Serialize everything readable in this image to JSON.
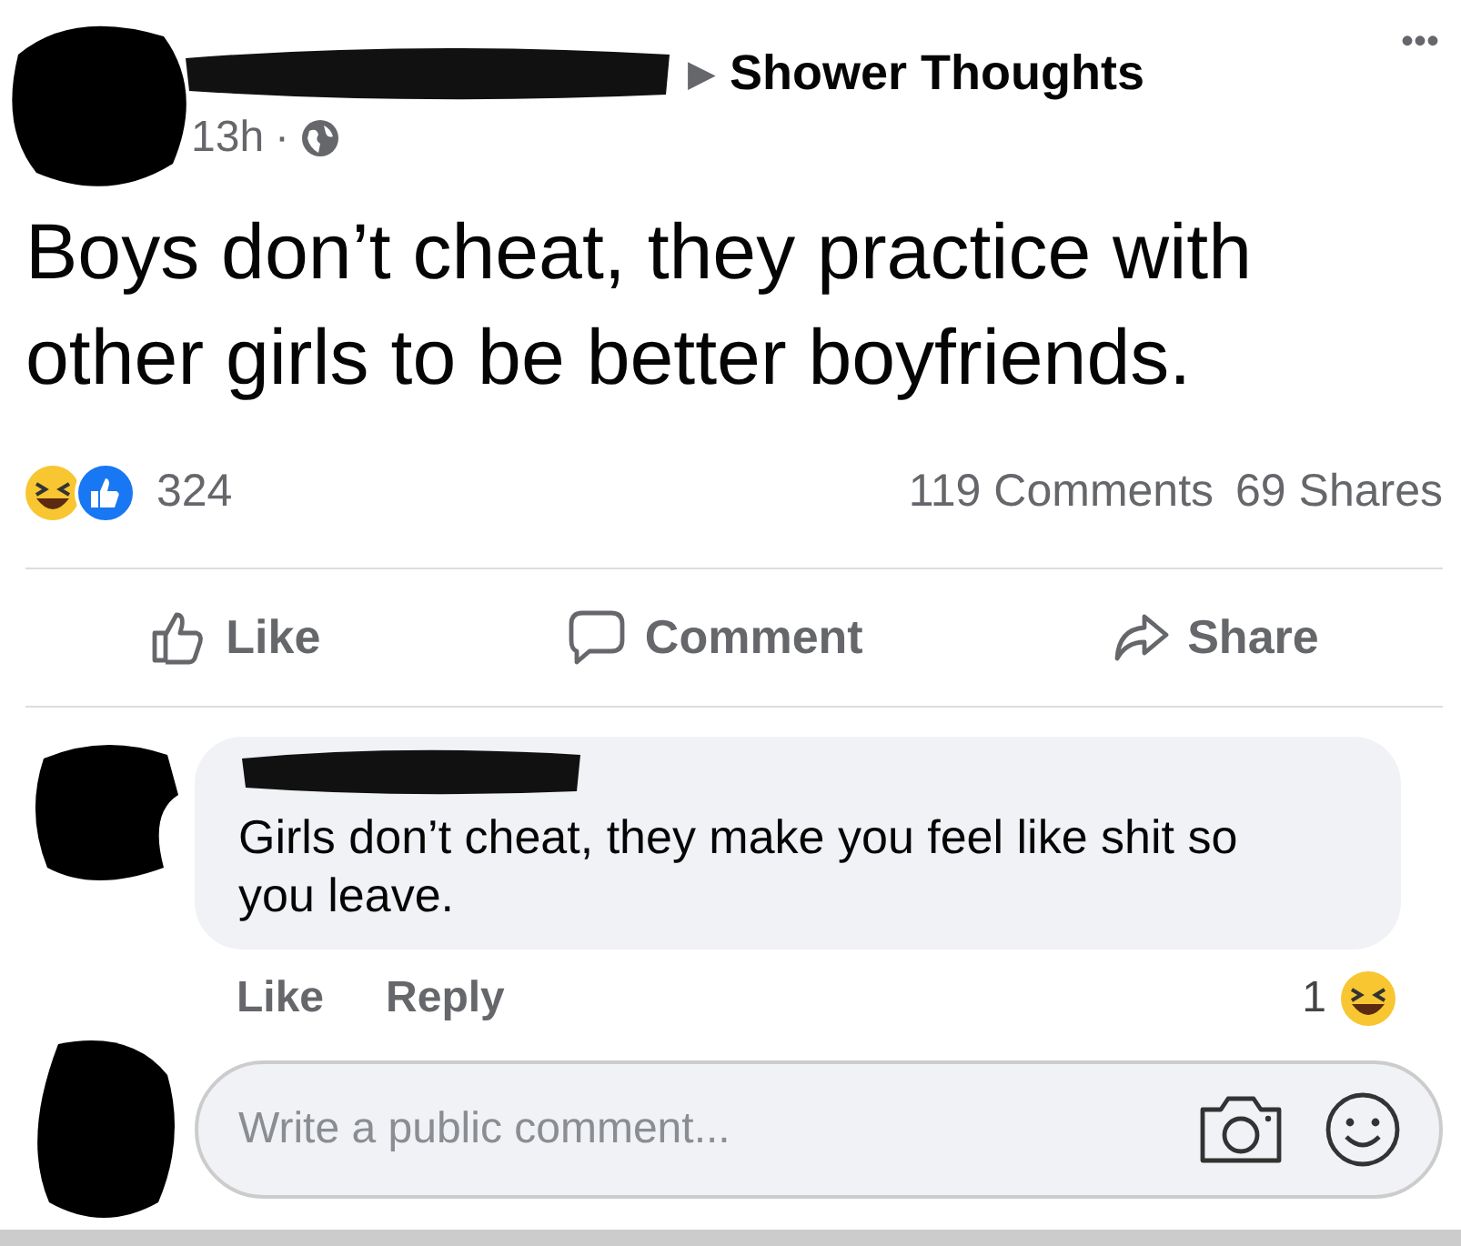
{
  "post": {
    "arrow": "▶",
    "page": "Shower Thoughts",
    "more": "•••",
    "time": "13h",
    "separator": "·",
    "text": "Boys don’t cheat, they practice with other girls to be better boyfriends.",
    "reaction_count": "324",
    "comments": "119 Comments",
    "shares": "69 Shares"
  },
  "actions": [
    {
      "label": "Like",
      "kind": "like"
    },
    {
      "label": "Comment",
      "kind": "comment"
    },
    {
      "label": "Share",
      "kind": "share"
    }
  ],
  "comment": {
    "text": "Girls don’t cheat, they make you feel like shit so you leave.",
    "actions": [
      "Like",
      "Reply"
    ],
    "reaction_count": "1"
  },
  "composer": {
    "placeholder": "Write a public comment..."
  }
}
